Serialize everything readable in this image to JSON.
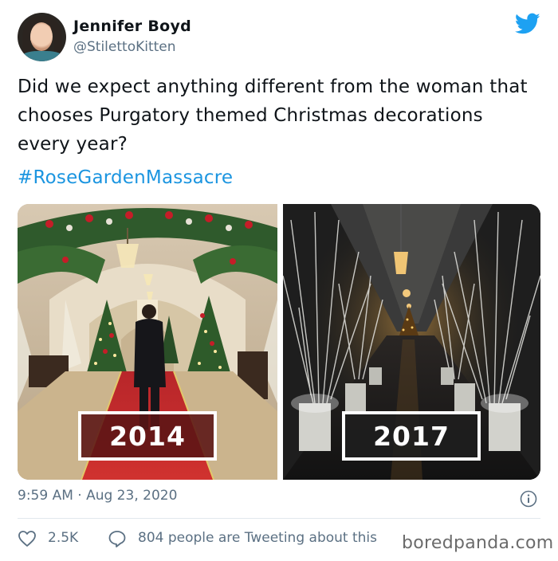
{
  "author": {
    "name": "Jennifer Boyd",
    "handle": "@StilettoKitten",
    "avatar_icon": "profile-photo"
  },
  "brand_icon": "twitter-bird-icon",
  "tweet": {
    "text": "Did we expect anything different from the woman that chooses Purgatory themed Christmas decorations every year?",
    "hashtag": "#RoseGardenMassacre"
  },
  "media": {
    "left_label": "2014",
    "right_label": "2017"
  },
  "meta": {
    "timestamp": "9:59 AM · Aug 23, 2020",
    "info_icon": "info-icon"
  },
  "actions": {
    "likes": "2.5K",
    "tweeting_about": "804 people are Tweeting about this"
  },
  "watermark": "boredpanda.com",
  "colors": {
    "link": "#1b95e0",
    "secondary_text": "#5b7083",
    "divider": "#e1e8ed"
  }
}
